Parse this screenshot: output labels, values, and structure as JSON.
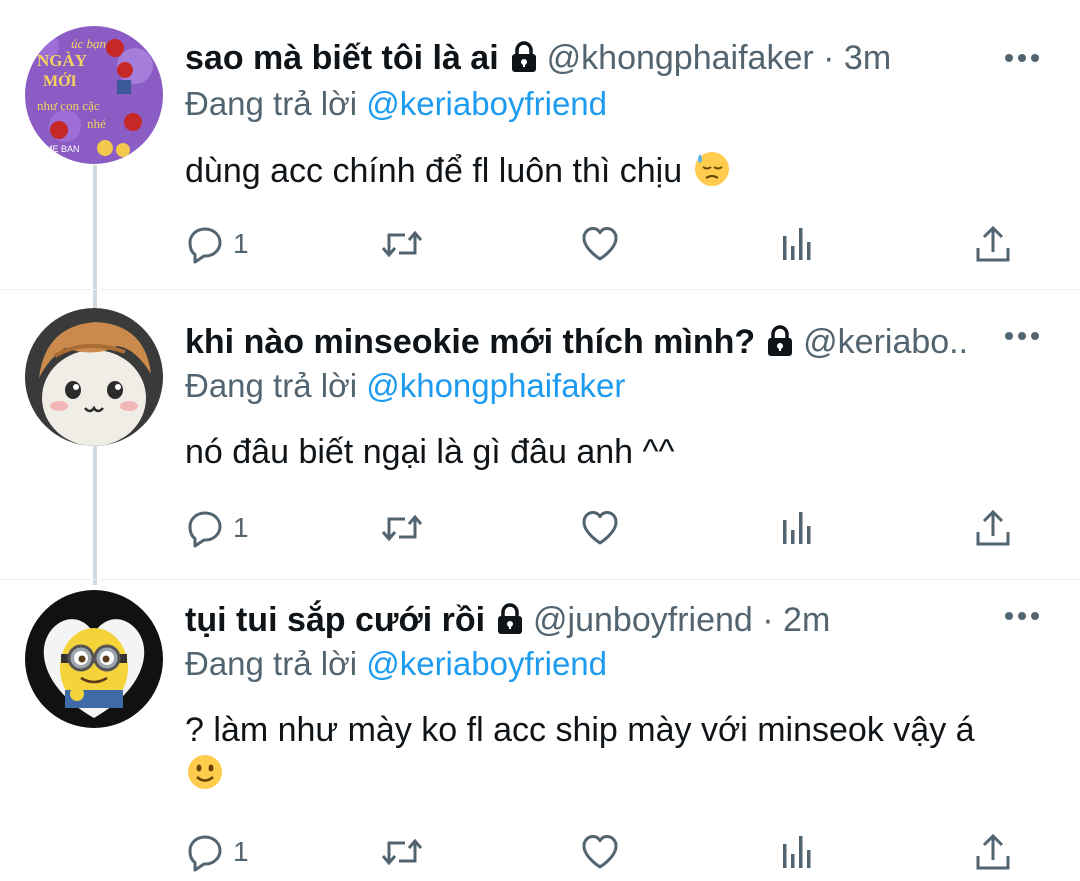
{
  "tweets": [
    {
      "name": "sao mà biết tôi là ai",
      "handle": "@khongphaifaker",
      "dot": "·",
      "time": "3m",
      "reply_prefix": "Đang trả lời ",
      "reply_mention": "@keriaboyfriend",
      "text": "dùng acc chính để fl luôn thì chịu",
      "reply_count": "1"
    },
    {
      "name": "khi nào minseokie mới thích mình?",
      "handle": "@keriabo...",
      "dot": "",
      "time": "",
      "reply_prefix": "Đang trả lời ",
      "reply_mention": "@khongphaifaker",
      "text": "nó đâu biết ngại là gì đâu anh ^^",
      "reply_count": "1"
    },
    {
      "name": "tụi tui sắp cưới rồi",
      "handle": "@junboyfriend",
      "dot": "·",
      "time": "2m",
      "reply_prefix": "Đang trả lời ",
      "reply_mention": "@keriaboyfriend",
      "text": "? làm như mày ko fl acc ship mày với minseok vậy á",
      "reply_count": "1"
    }
  ],
  "avatar_texts": {
    "t1_line1": "úc bạn",
    "t1_line2": "NGÀY",
    "t1_line3": "MỚI",
    "t1_line4": "như con cặc",
    "t1_line5": "nhé",
    "t1_line6": "ME BAN"
  },
  "colors": {
    "accent": "#1d9bf0",
    "secondary": "#536471",
    "primary_text": "#0f1419"
  },
  "icons": {
    "lock": "lock-icon",
    "more": "more-icon",
    "reply": "reply-icon",
    "retweet": "retweet-icon",
    "like": "like-icon",
    "views": "views-icon",
    "share": "share-icon"
  }
}
